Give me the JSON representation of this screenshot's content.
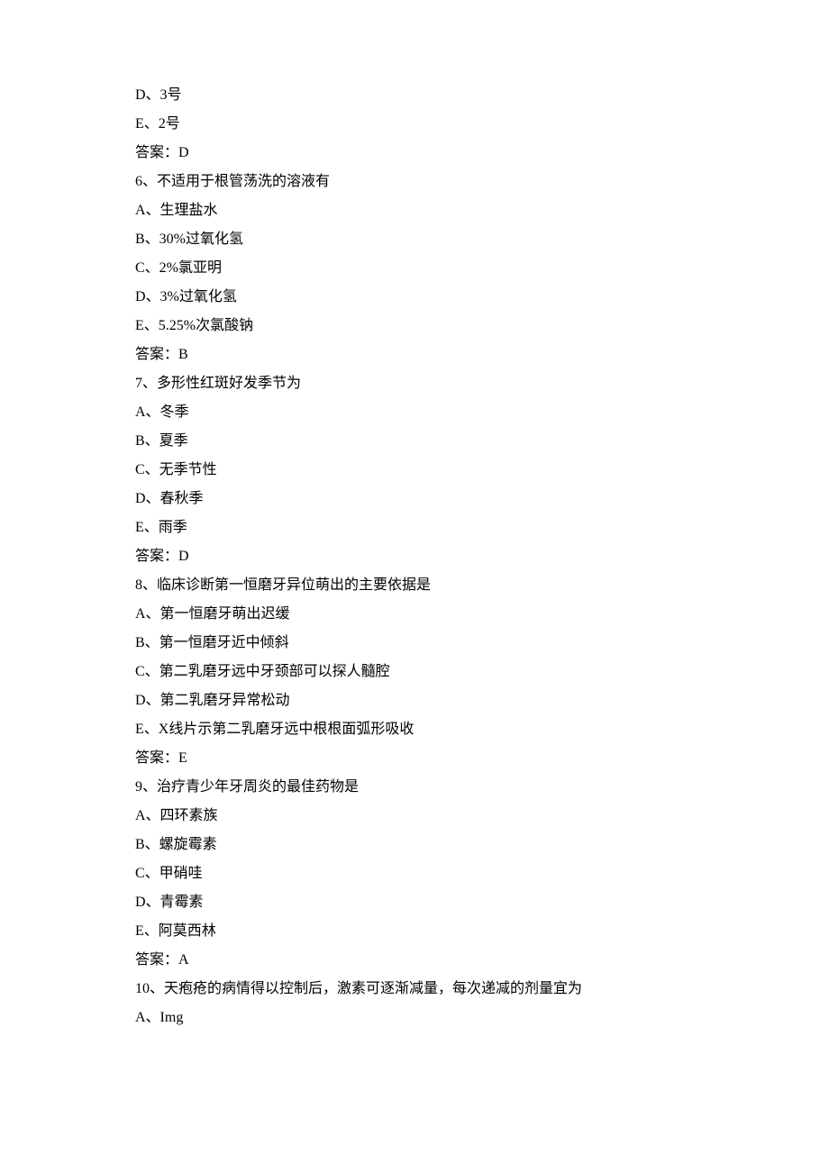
{
  "lines": [
    "D、3号",
    "E、2号",
    "答案：D",
    "6、不适用于根管荡洗的溶液有",
    "A、生理盐水",
    "B、30%过氧化氢",
    "C、2%氯亚明",
    "D、3%过氧化氢",
    "E、5.25%次氯酸钠",
    "答案：B",
    "7、多形性红斑好发季节为",
    "A、冬季",
    "B、夏季",
    "C、无季节性",
    "D、春秋季",
    "E、雨季",
    "答案：D",
    "8、临床诊断第一恒磨牙异位萌出的主要依据是",
    "A、第一恒磨牙萌出迟缓",
    "B、第一恒磨牙近中倾斜",
    "C、第二乳磨牙远中牙颈部可以探人髓腔",
    "D、第二乳磨牙异常松动",
    "E、X线片示第二乳磨牙远中根根面弧形吸收",
    "答案：E",
    "9、治疗青少年牙周炎的最佳药物是",
    "A、四环素族",
    "B、螺旋霉素",
    "C、甲硝哇",
    "D、青霉素",
    "E、阿莫西林",
    "答案：A",
    "10、天疱疮的病情得以控制后，激素可逐渐减量，每次递减的剂量宜为",
    "A、Img"
  ]
}
